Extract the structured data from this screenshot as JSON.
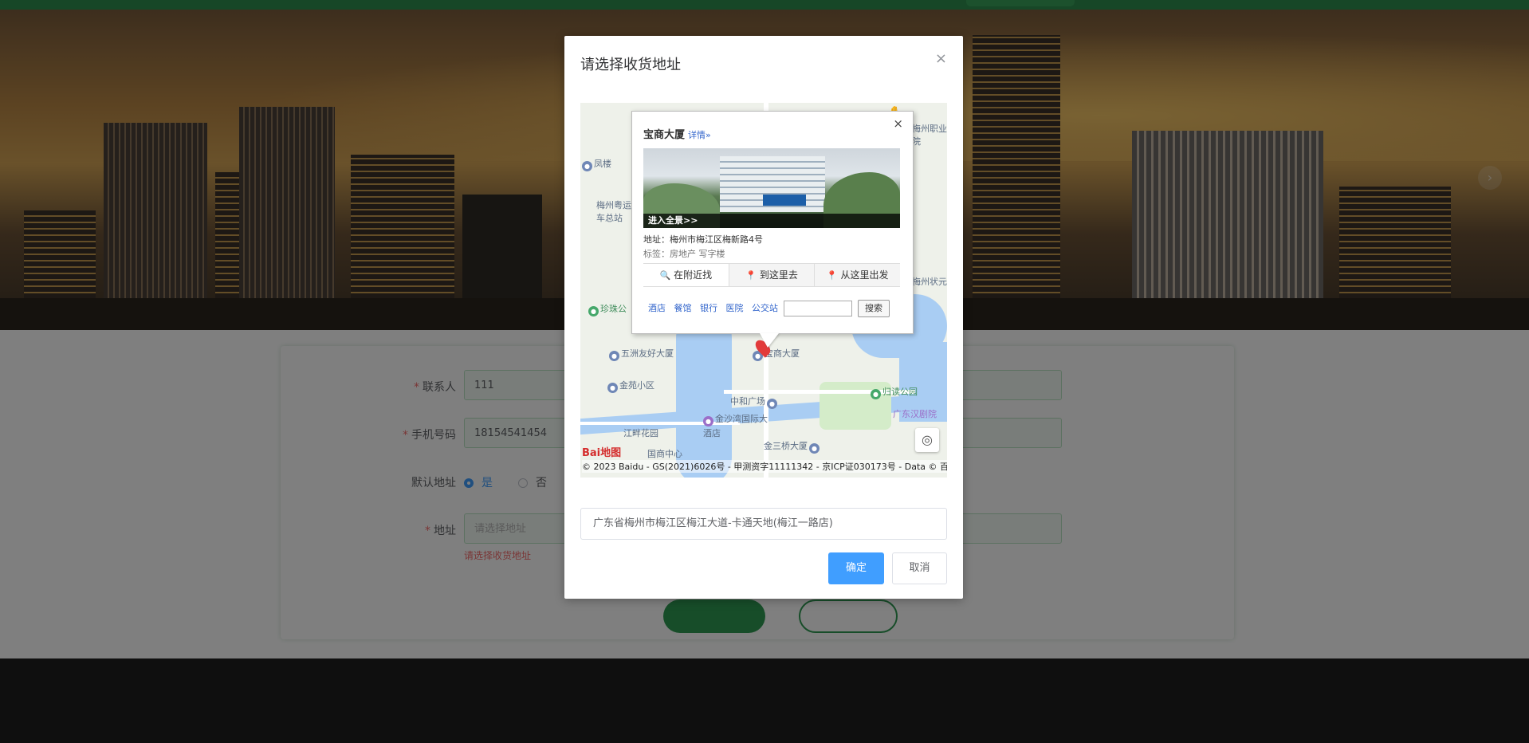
{
  "page": {
    "form": {
      "contact_label": "联系人",
      "contact_value": "111",
      "phone_label": "手机号码",
      "phone_value": "18154541454",
      "default_label": "默认地址",
      "default_yes": "是",
      "default_no": "否",
      "address_label": "地址",
      "address_placeholder": "请选择地址",
      "address_error": "请选择收货地址"
    }
  },
  "dialog": {
    "title": "请选择收货地址",
    "close_icon": "×",
    "confirm_label": "确定",
    "cancel_label": "取消",
    "selected_address": "广东省梅州市梅江区梅江大道-卡通天地(梅江一路店)"
  },
  "map": {
    "info_window": {
      "name": "宝商大厦",
      "detail_link": "详情»",
      "panorama_label": "进入全景>>",
      "address": "地址：梅州市梅江区梅新路4号",
      "tags": "标签：房地产 写字楼",
      "tabs": [
        "在附近找",
        "到这里去",
        "从这里出发"
      ],
      "nearby": [
        "酒店",
        "餐馆",
        "银行",
        "医院",
        "公交站"
      ],
      "search_button": "搜索",
      "close_icon": "×"
    },
    "pois": [
      "凤楼",
      "梅州粤运汽车总站",
      "珍珠公",
      "五洲友好大厦",
      "宝商大厦",
      "金苑小区",
      "中和广场",
      "金沙湾国际大酒店",
      "江畔花园",
      "金三桥大厦",
      "国商中心",
      "归读公园",
      "广东汉剧院",
      "梅州职业院",
      "梅州状元"
    ],
    "logo": "Bai地图",
    "copyright": "© 2023 Baidu - GS(2021)6026号 - 甲测资字11111342 - 京ICP证030173号 - Data © 百度"
  },
  "colors": {
    "accent": "#409eff",
    "brand_green": "#2f8f4f",
    "error": "#f56c6c"
  }
}
